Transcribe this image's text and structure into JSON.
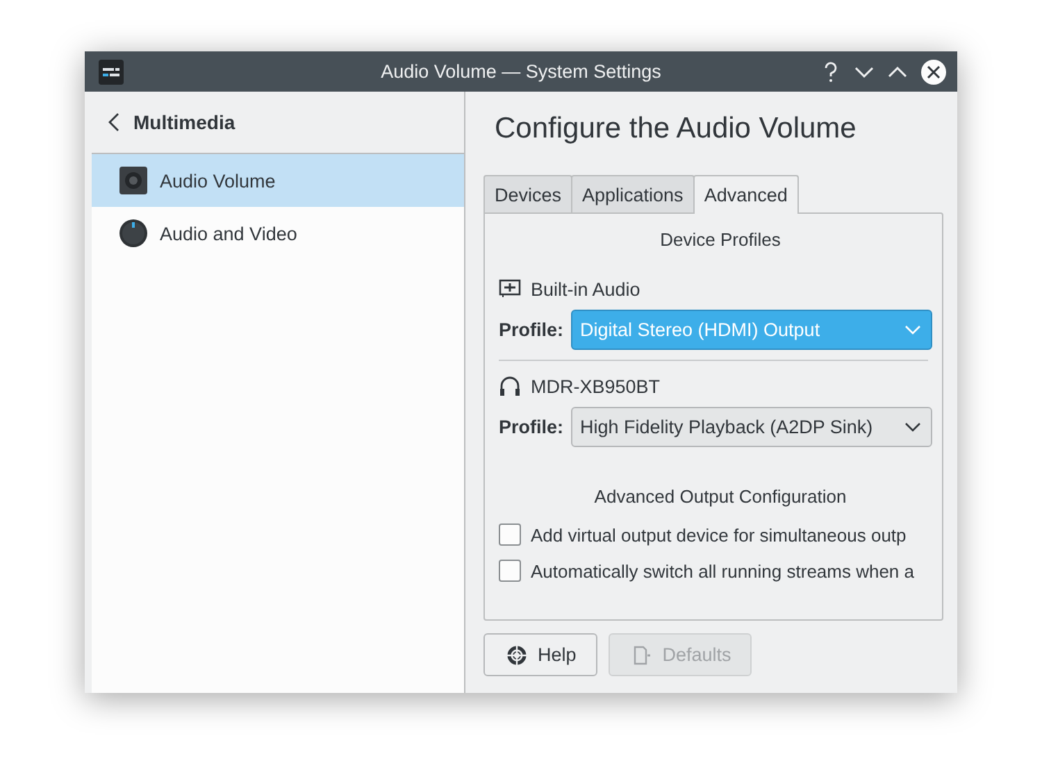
{
  "window": {
    "title": "Audio Volume — System Settings"
  },
  "sidebar": {
    "back_label": "Multimedia",
    "items": [
      {
        "label": "Audio Volume",
        "kind": "speaker",
        "selected": true
      },
      {
        "label": "Audio and Video",
        "kind": "knob",
        "selected": false
      }
    ]
  },
  "page_title": "Configure the Audio Volume",
  "tabs": [
    {
      "label": "Devices",
      "selected": false
    },
    {
      "label": "Applications",
      "selected": false
    },
    {
      "label": "Advanced",
      "selected": true
    }
  ],
  "device_profiles": {
    "heading": "Device Profiles",
    "devices": [
      {
        "name": "Built-in Audio",
        "kind": "card",
        "profile_label": "Profile:",
        "profile": "Digital Stereo (HDMI) Output",
        "focused": true
      },
      {
        "name": "MDR-XB950BT",
        "kind": "headphones",
        "profile_label": "Profile:",
        "profile": "High Fidelity Playback (A2DP Sink)",
        "focused": false
      }
    ]
  },
  "advanced_output": {
    "heading": "Advanced Output Configuration",
    "options": [
      {
        "label": "Add virtual output device for simultaneous outp",
        "checked": false
      },
      {
        "label": "Automatically switch all running streams when a",
        "checked": false
      }
    ]
  },
  "buttons": [
    {
      "label": "Help",
      "kind": "help",
      "disabled": false
    },
    {
      "label": "Defaults",
      "kind": "defaults",
      "disabled": true
    }
  ]
}
